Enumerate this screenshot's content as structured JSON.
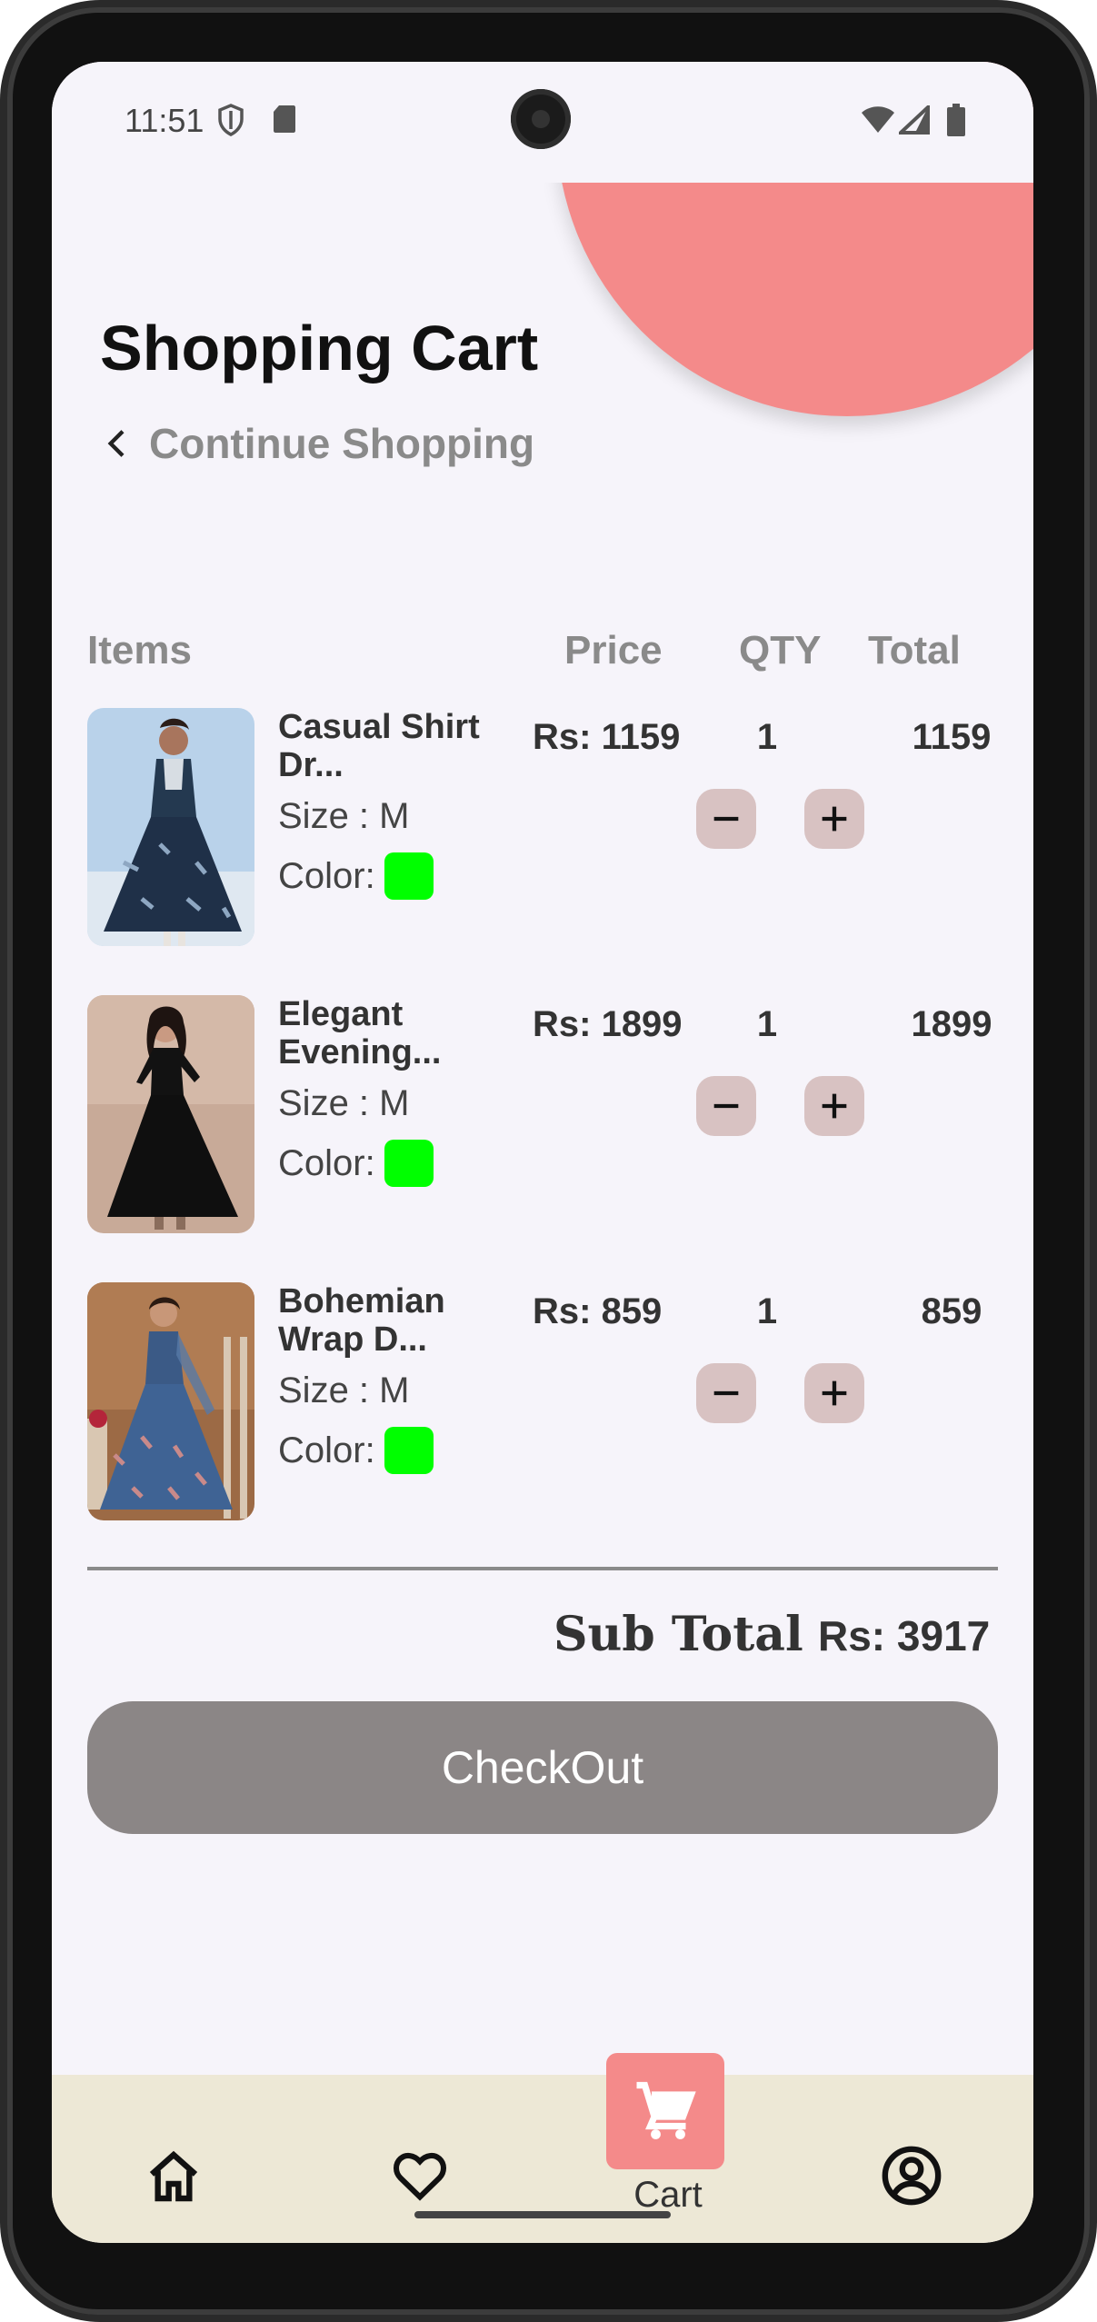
{
  "status_bar": {
    "time": "11:51"
  },
  "header": {
    "title": "Shopping Cart",
    "continue_label": "Continue Shopping",
    "accent_color": "#f48a8a"
  },
  "table": {
    "headers": {
      "items": "Items",
      "price": "Price",
      "qty": "QTY",
      "total": "Total"
    },
    "rows": [
      {
        "name_line1": "Casual Shirt",
        "name_line2": "Dr...",
        "size": "Size : M",
        "color_label": "Color:",
        "color": "#00ff00",
        "price": "Rs: 1159",
        "qty": "1",
        "total": "1159"
      },
      {
        "name_line1": "Elegant",
        "name_line2": "Evening...",
        "size": "Size : M",
        "color_label": "Color:",
        "color": "#00ff00",
        "price": "Rs: 1899",
        "qty": "1",
        "total": "1899"
      },
      {
        "name_line1": "Bohemian",
        "name_line2": "Wrap D...",
        "size": "Size : M",
        "color_label": "Color:",
        "color": "#00ff00",
        "price": "Rs: 859",
        "qty": "1",
        "total": "859"
      }
    ]
  },
  "summary": {
    "subtotal_label": "Sub Total",
    "subtotal_value": "Rs: 3917"
  },
  "checkout_label": "CheckOut",
  "bottom_nav": {
    "items": [
      {
        "icon": "home-icon"
      },
      {
        "icon": "heart-icon"
      },
      {
        "icon": "cart-icon",
        "label": "Cart",
        "active": true
      },
      {
        "icon": "account-icon"
      }
    ]
  }
}
